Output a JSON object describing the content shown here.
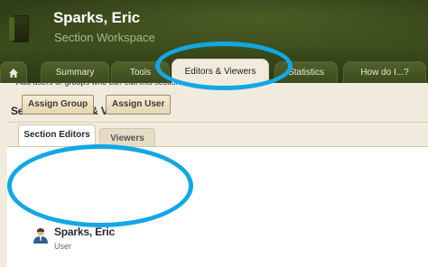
{
  "header": {
    "owner_name": "Sparks, Eric",
    "subtitle": "Section Workspace"
  },
  "tabs": [
    {
      "label": "Summary"
    },
    {
      "label": "Tools"
    },
    {
      "label": "Editors & Viewers",
      "active": true
    },
    {
      "label": "Statistics"
    },
    {
      "label": "How do I...?"
    }
  ],
  "home_icon": "home-icon",
  "page": {
    "title": "Section Editors & Viewers",
    "subtabs": [
      {
        "label": "Section Editors",
        "active": true
      },
      {
        "label": "Viewers"
      }
    ],
    "help_text": "Add users or groups who can edit this section.",
    "buttons": {
      "assign_group": "Assign Group",
      "assign_user": "Assign User"
    },
    "editors": [
      {
        "name": "Sparks, Eric",
        "role": "User",
        "icon": "user-icon"
      }
    ]
  },
  "annotation_color": "#12a7e6"
}
